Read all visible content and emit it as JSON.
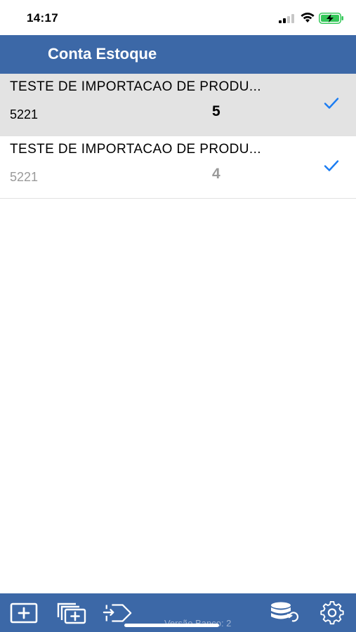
{
  "status_bar": {
    "time": "14:17",
    "icons": [
      "cellular-signal-icon",
      "wifi-icon",
      "battery-charging-icon"
    ],
    "battery_color": "#34c759"
  },
  "header": {
    "title": "Conta Estoque",
    "background_color": "#3c68a7"
  },
  "items": [
    {
      "title": "TESTE DE IMPORTACAO DE PRODU...",
      "code": "5221",
      "quantity": "5",
      "checked": true,
      "selected": true
    },
    {
      "title": "TESTE DE IMPORTACAO DE PRODU...",
      "code": "5221",
      "quantity": "4",
      "checked": true,
      "selected": false
    }
  ],
  "check_color": "#1a7cf2",
  "toolbar": {
    "buttons": [
      "add-item-icon",
      "add-multiple-icon",
      "import-tag-icon",
      "database-sync-icon",
      "settings-gear-icon"
    ],
    "version_label": "Versão Banco: 2"
  }
}
